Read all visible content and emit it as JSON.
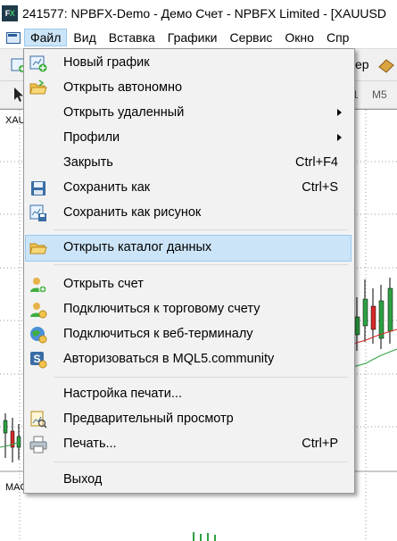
{
  "window": {
    "title": "241577: NPBFX-Demo - Демо Счет - NPBFX Limited - [XAUUSD"
  },
  "menubar": {
    "items": [
      "Файл",
      "Вид",
      "Вставка",
      "Графики",
      "Сервис",
      "Окно",
      "Спр"
    ]
  },
  "toolbar": {
    "partial_label": "ер",
    "timeframe_m1": "1",
    "timeframe_m5": "M5"
  },
  "chart": {
    "symbol_label": "XAU",
    "indicator_label": "MAC"
  },
  "file_menu": {
    "items": [
      {
        "label": "Новый график",
        "icon": "new-chart-icon",
        "shortcut": ""
      },
      {
        "label": "Открыть автономно",
        "icon": "open-folder-icon",
        "shortcut": ""
      },
      {
        "label": "Открыть удаленный",
        "icon": "",
        "shortcut": "",
        "submenu": true
      },
      {
        "label": "Профили",
        "icon": "",
        "shortcut": "",
        "submenu": true
      },
      {
        "label": "Закрыть",
        "icon": "",
        "shortcut": "Ctrl+F4"
      },
      {
        "label": "Сохранить как",
        "icon": "save-icon",
        "shortcut": "Ctrl+S"
      },
      {
        "label": "Сохранить как рисунок",
        "icon": "save-picture-icon",
        "shortcut": ""
      },
      {
        "label": "Открыть каталог данных",
        "icon": "folder-icon",
        "shortcut": "",
        "highlighted": true
      },
      {
        "label": "Открыть счет",
        "icon": "open-account-icon",
        "shortcut": ""
      },
      {
        "label": "Подключиться к торговому счету",
        "icon": "login-account-icon",
        "shortcut": ""
      },
      {
        "label": "Подключиться к веб-терминалу",
        "icon": "web-terminal-icon",
        "shortcut": ""
      },
      {
        "label": "Авторизоваться в MQL5.community",
        "icon": "mql5-community-icon",
        "shortcut": ""
      },
      {
        "label": "Настройка печати...",
        "icon": "",
        "shortcut": ""
      },
      {
        "label": "Предварительный просмотр",
        "icon": "print-preview-icon",
        "shortcut": ""
      },
      {
        "label": "Печать...",
        "icon": "printer-icon",
        "shortcut": "Ctrl+P"
      },
      {
        "label": "Выход",
        "icon": "",
        "shortcut": ""
      }
    ]
  },
  "colors": {
    "highlight_bg": "#cce4f7",
    "highlight_border": "#99c9ef",
    "bull_candle": "#2ea043",
    "bear_candle": "#d62828"
  }
}
